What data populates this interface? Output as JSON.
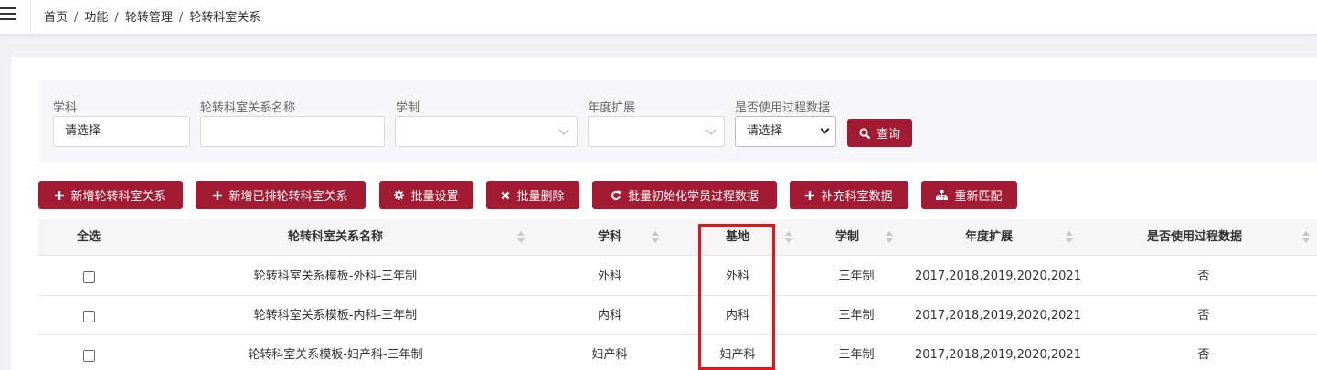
{
  "breadcrumb": {
    "items": [
      "首页",
      "功能",
      "轮转管理",
      "轮转科室关系"
    ],
    "separator": "/"
  },
  "filters": {
    "subject": {
      "label": "学科",
      "value": "请选择"
    },
    "relation_name": {
      "label": "轮转科室关系名称",
      "value": ""
    },
    "schooling": {
      "label": "学制",
      "value": ""
    },
    "year_ext": {
      "label": "年度扩展",
      "value": ""
    },
    "use_process": {
      "label": "是否使用过程数据",
      "value": "请选择"
    },
    "query_label": "查询"
  },
  "toolbar": {
    "add_relation": "新增轮转科室关系",
    "add_scheduled": "新增已排轮转科室关系",
    "batch_settings": "批量设置",
    "batch_delete": "批量删除",
    "batch_init": "批量初始化学员过程数据",
    "supplement": "补充科室数据",
    "rematch": "重新匹配"
  },
  "table": {
    "headers": {
      "select_all": "全选",
      "name": "轮转科室关系名称",
      "subject": "学科",
      "base": "基地",
      "schooling": "学制",
      "year_ext": "年度扩展",
      "use_process": "是否使用过程数据"
    },
    "rows": [
      {
        "name": "轮转科室关系模板-外科-三年制",
        "subject": "外科",
        "base": "外科",
        "schooling": "三年制",
        "year_ext": "2017,2018,2019,2020,2021",
        "use_process": "否"
      },
      {
        "name": "轮转科室关系模板-内科-三年制",
        "subject": "内科",
        "base": "内科",
        "schooling": "三年制",
        "year_ext": "2017,2018,2019,2020,2021",
        "use_process": "否"
      },
      {
        "name": "轮转科室关系模板-妇产科-三年制",
        "subject": "妇产科",
        "base": "妇产科",
        "schooling": "三年制",
        "year_ext": "2017,2018,2019,2020,2021",
        "use_process": "否"
      }
    ]
  },
  "colors": {
    "accent": "#a31b32",
    "highlight": "#e0161b"
  },
  "icons": {
    "menu": "hamburger-icon",
    "query": "search-icon",
    "add": "plus-icon",
    "settings": "gear-icon",
    "delete": "x-icon",
    "refresh": "refresh-icon",
    "rematch": "sitemap-icon"
  }
}
